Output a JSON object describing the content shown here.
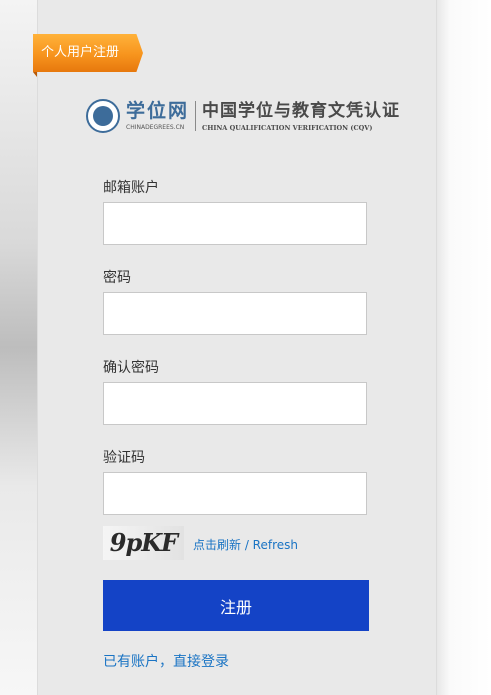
{
  "ribbon": {
    "label": "个人用户注册"
  },
  "logo": {
    "brand_cn": "学位网",
    "brand_en": "CHINADEGREES.CN",
    "title": "中国学位与教育文凭认证",
    "subtitle": "CHINA QUALIFICATION VERIFICATION (CQV)"
  },
  "form": {
    "email_label": "邮箱账户",
    "email_value": "",
    "password_label": "密码",
    "password_value": "",
    "confirm_label": "确认密码",
    "confirm_value": "",
    "captcha_label": "验证码",
    "captcha_value": "",
    "captcha_image_text": "9pKF",
    "refresh_link": "点击刷新 / Refresh",
    "submit_label": "注册",
    "login_link": "已有账户，直接登录"
  },
  "colors": {
    "ribbon": "#f7941d",
    "submit": "#1443c6",
    "link": "#1a74c4",
    "panel": "#e9e9e9",
    "brand_blue": "#3d6c9a"
  }
}
